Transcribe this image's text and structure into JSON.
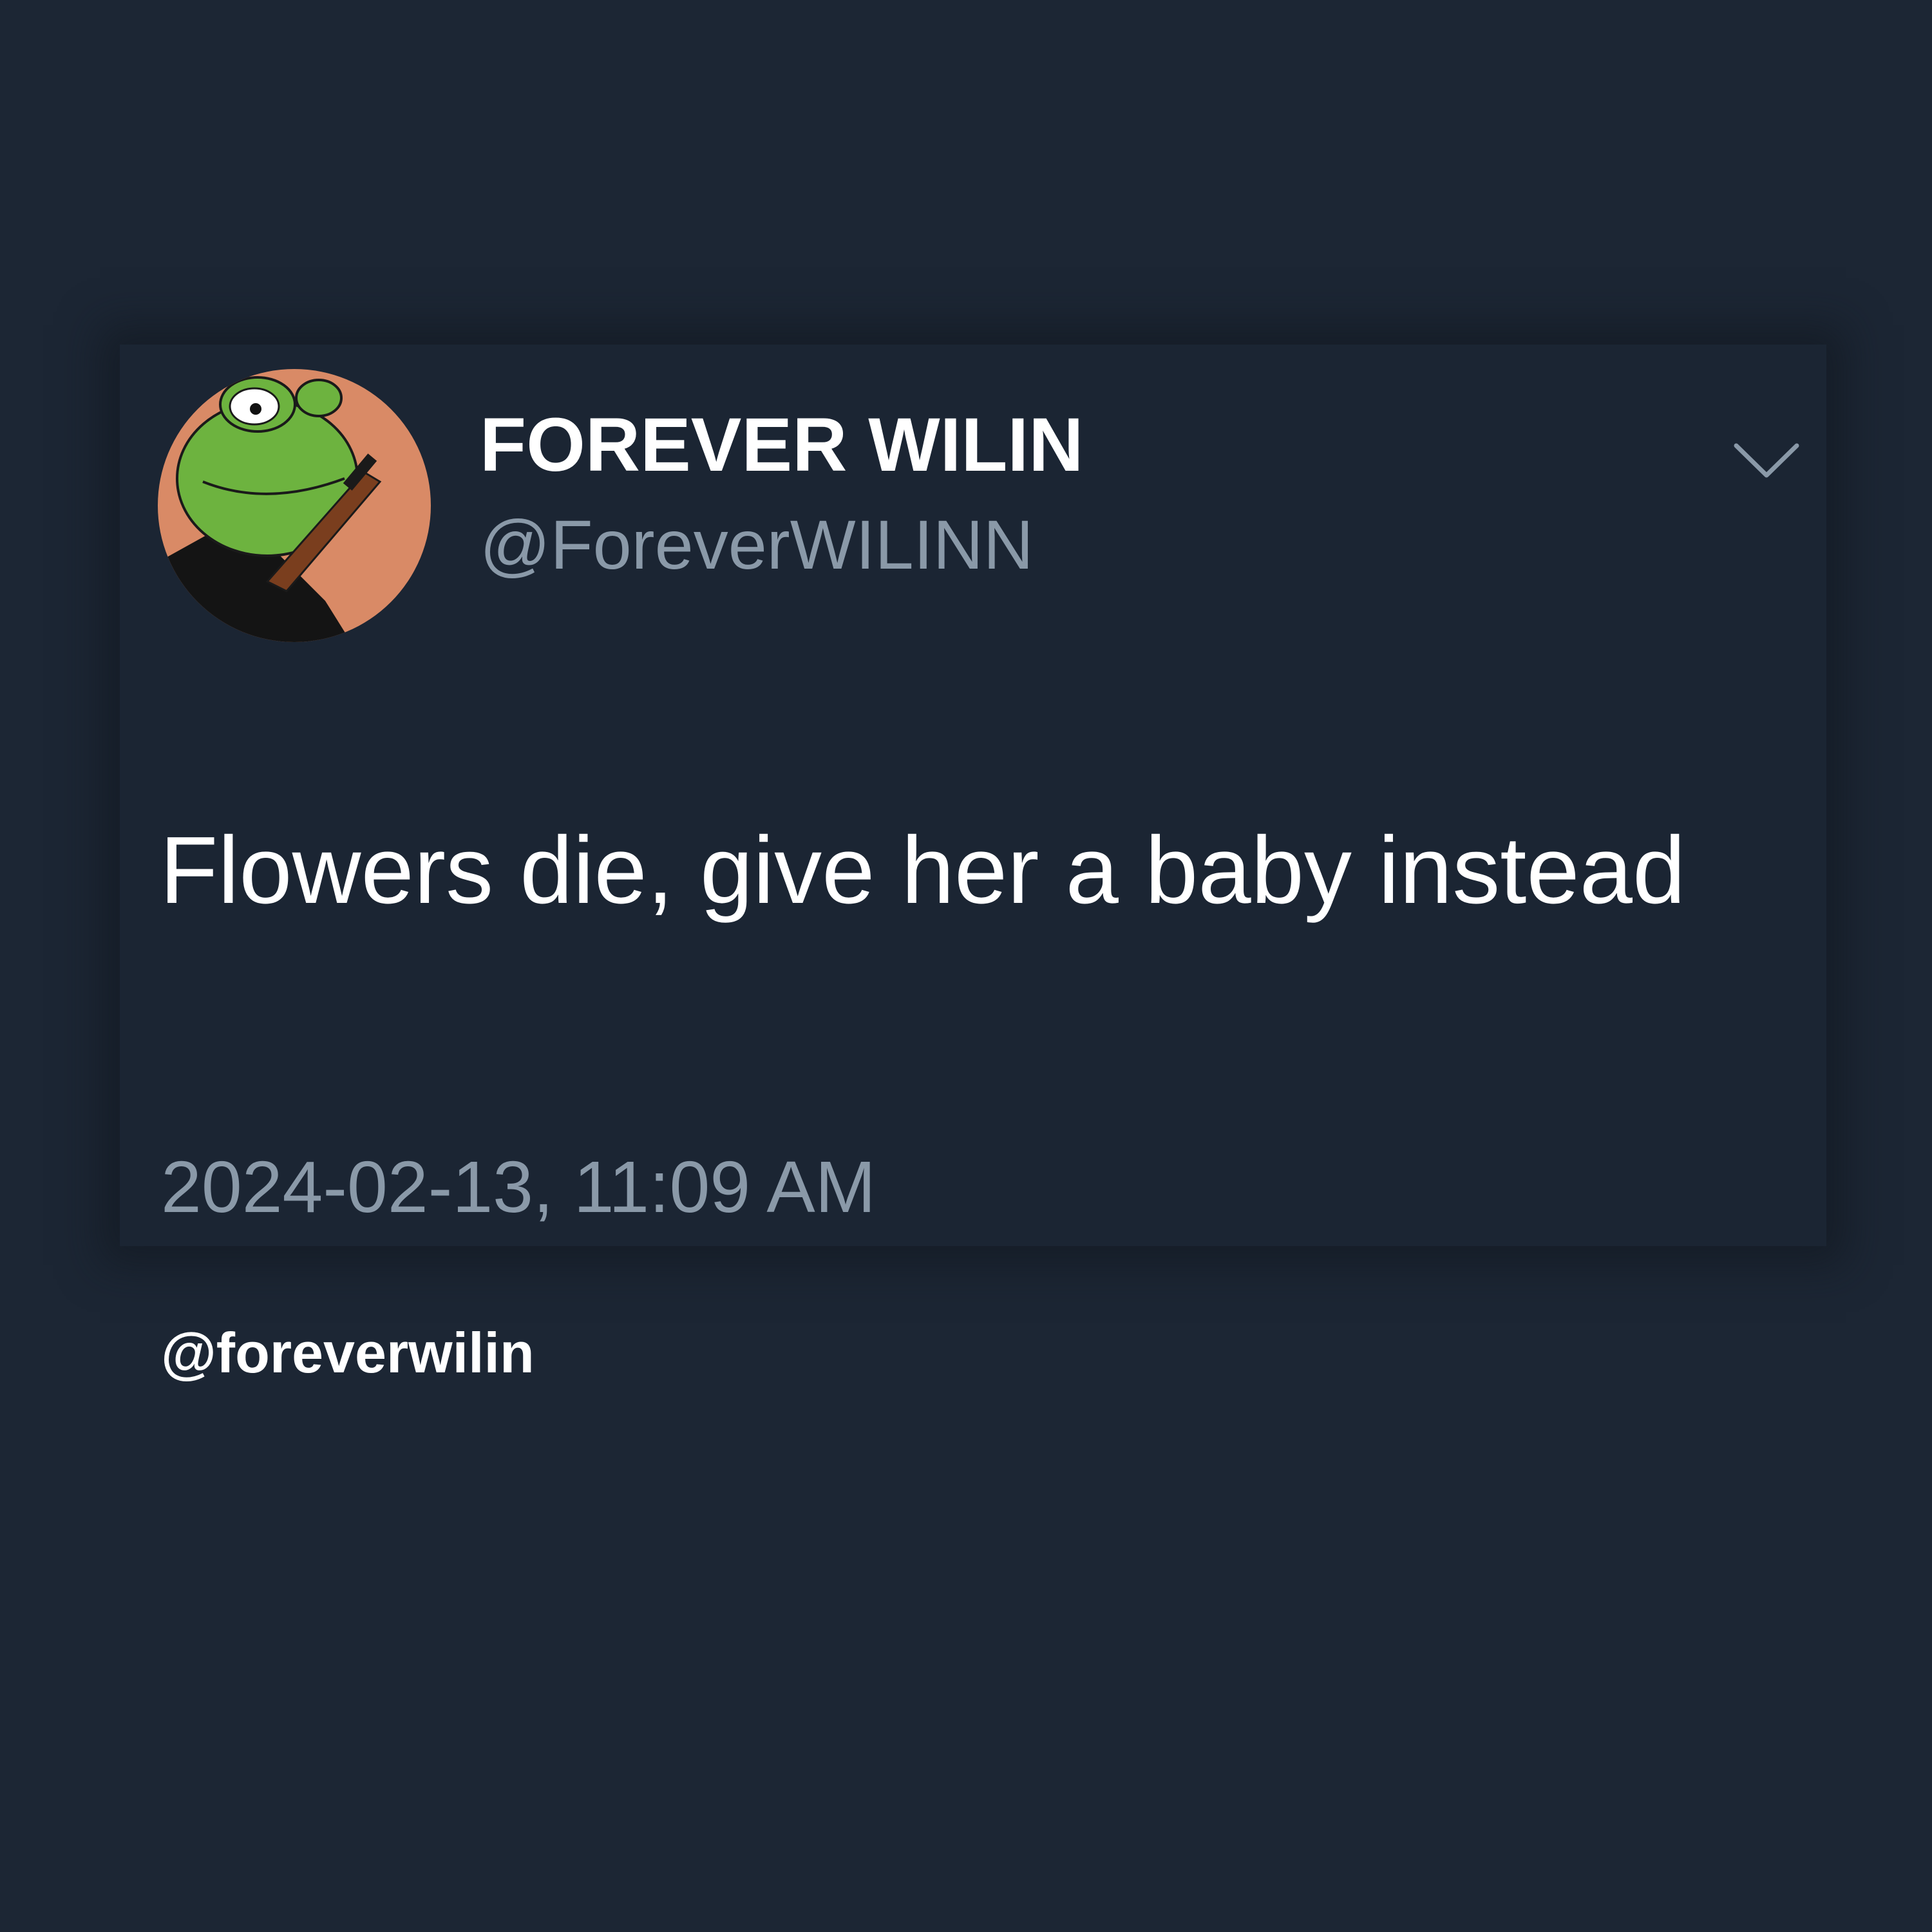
{
  "tweet": {
    "display_name": "FOREVER WILIN",
    "handle": "@ForeverWILINN",
    "text": "Flowers die, give her a baby instead",
    "timestamp": "2024-02-13, 11:09 AM",
    "avatar": {
      "icon": "frog-avatar-icon",
      "background_color": "#d98a66",
      "frog_color": "#6db33f"
    },
    "menu_icon": "chevron-down-icon"
  },
  "watermark": "@foreverwilin",
  "colors": {
    "background": "#1c2634",
    "primary_text": "#ffffff",
    "secondary_text": "#8a99a8"
  }
}
